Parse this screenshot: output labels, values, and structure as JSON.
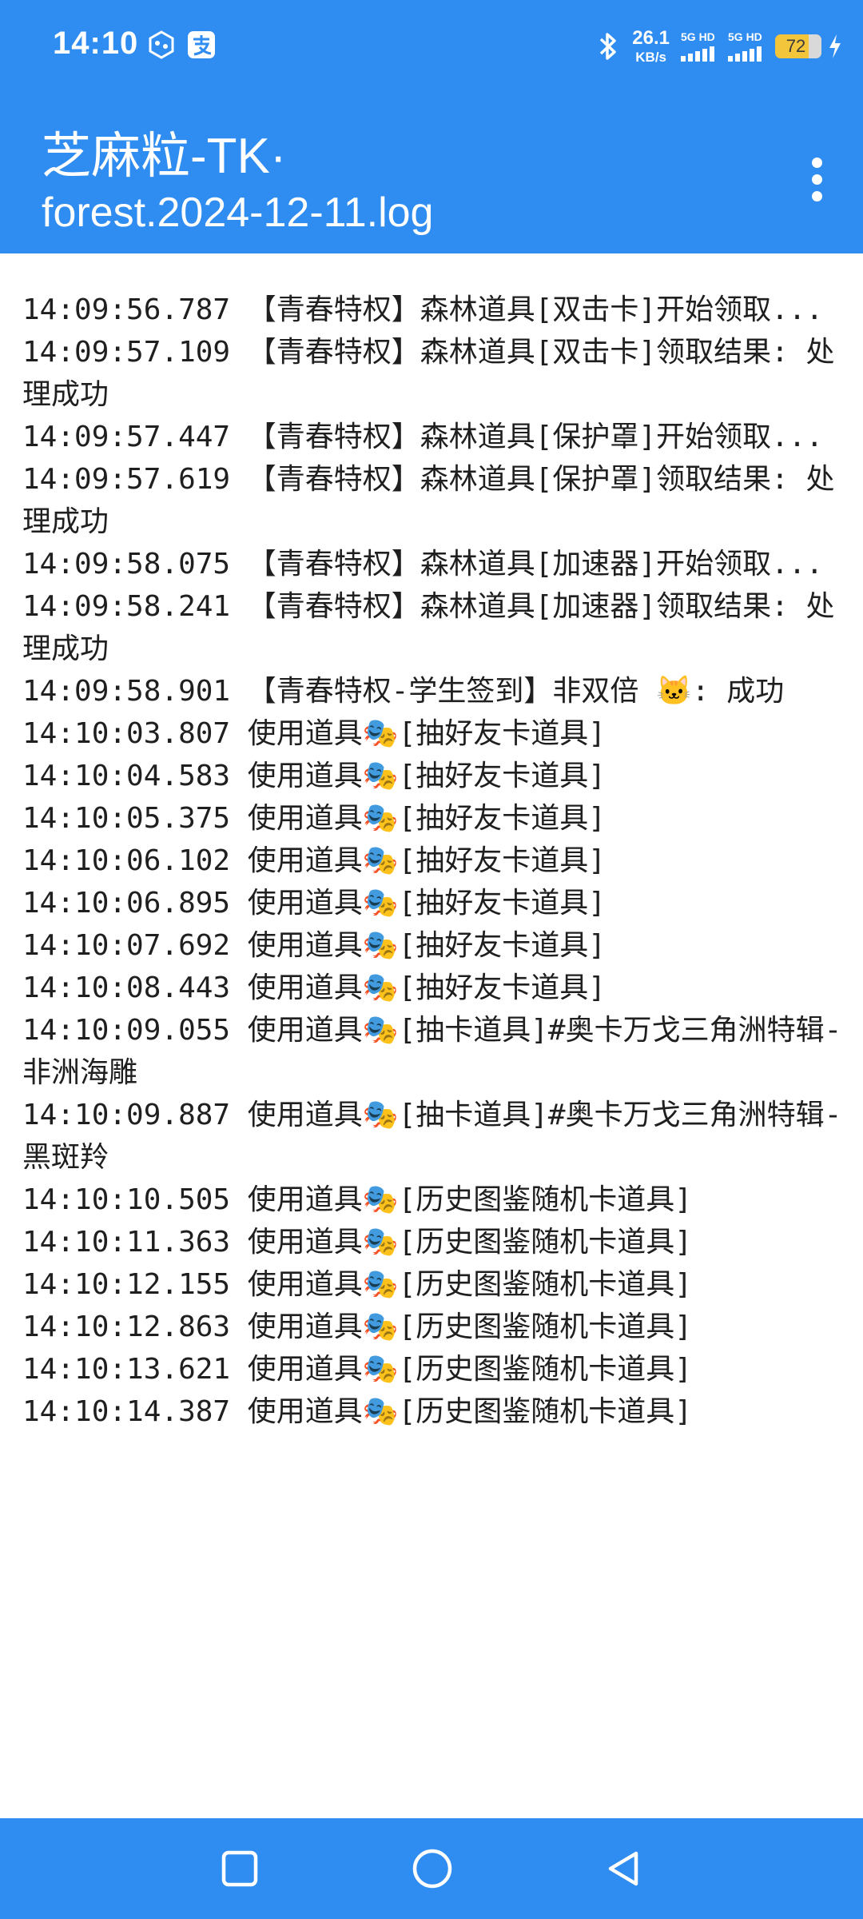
{
  "status_bar": {
    "time": "14:10",
    "net_speed_value": "26.1",
    "net_speed_unit": "KB/s",
    "sim1_label": "5G HD",
    "sim2_label": "5G HD",
    "battery_level": "72",
    "icons": [
      "notification-app-icon",
      "alipay-icon",
      "bluetooth-icon",
      "signal-icon",
      "signal-icon",
      "battery-icon",
      "charging-icon"
    ]
  },
  "app_bar": {
    "title": "芝麻粒-TK·",
    "subtitle": "forest.2024-12-11.log",
    "menu_icon": "more-vert-icon"
  },
  "log_lines": [
    "14:09:56.787 【青春特权】森林道具[双击卡]开始领取...",
    "14:09:57.109 【青春特权】森林道具[双击卡]领取结果: 处理成功",
    "14:09:57.447 【青春特权】森林道具[保护罩]开始领取...",
    "14:09:57.619 【青春特权】森林道具[保护罩]领取结果: 处理成功",
    "14:09:58.075 【青春特权】森林道具[加速器]开始领取...",
    "14:09:58.241 【青春特权】森林道具[加速器]领取结果: 处理成功",
    "14:09:58.901 【青春特权-学生签到】非双倍 🐱: 成功",
    "14:10:03.807 使用道具🎭[抽好友卡道具]",
    "14:10:04.583 使用道具🎭[抽好友卡道具]",
    "14:10:05.375 使用道具🎭[抽好友卡道具]",
    "14:10:06.102 使用道具🎭[抽好友卡道具]",
    "14:10:06.895 使用道具🎭[抽好友卡道具]",
    "14:10:07.692 使用道具🎭[抽好友卡道具]",
    "14:10:08.443 使用道具🎭[抽好友卡道具]",
    "14:10:09.055 使用道具🎭[抽卡道具]#奥卡万戈三角洲特辑-非洲海雕",
    "14:10:09.887 使用道具🎭[抽卡道具]#奥卡万戈三角洲特辑-黑斑羚",
    "14:10:10.505 使用道具🎭[历史图鉴随机卡道具]",
    "14:10:11.363 使用道具🎭[历史图鉴随机卡道具]",
    "14:10:12.155 使用道具🎭[历史图鉴随机卡道具]",
    "14:10:12.863 使用道具🎭[历史图鉴随机卡道具]",
    "14:10:13.621 使用道具🎭[历史图鉴随机卡道具]",
    "14:10:14.387 使用道具🎭[历史图鉴随机卡道具]"
  ],
  "nav_bar": {
    "icons": [
      "recents-square-icon",
      "home-circle-icon",
      "back-triangle-icon"
    ]
  },
  "colors": {
    "accent": "#2f8cf0",
    "battery": "#f3c53b",
    "text": "#1f1f1f"
  }
}
